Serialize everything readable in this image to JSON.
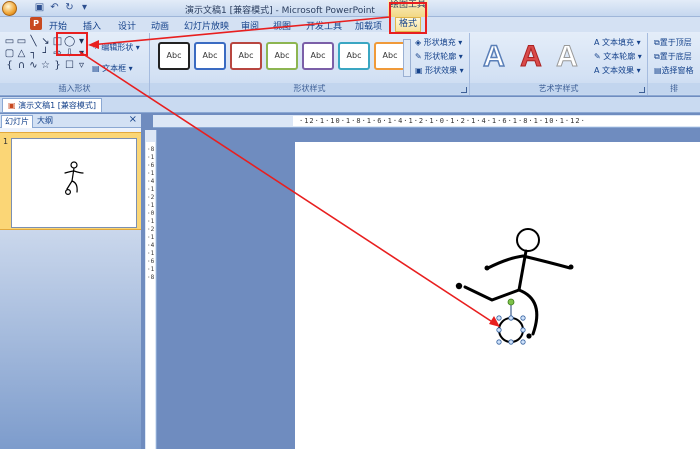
{
  "titlebar": {
    "title": "演示文稿1 [兼容模式] - Microsoft PowerPoint",
    "contextual_tab_group": "绘图工具"
  },
  "tabs": [
    "开始",
    "插入",
    "设计",
    "动画",
    "幻灯片放映",
    "审阅",
    "视图",
    "开发工具",
    "加载项",
    "格式"
  ],
  "active_tab": "格式",
  "ribbon": {
    "insert_shapes": {
      "label": "插入形状",
      "edit_shape": "编辑形状",
      "text_box": "文本框"
    },
    "shape_styles": {
      "label": "形状样式",
      "style_text": "Abc",
      "fill": "形状填充",
      "outline": "形状轮廓",
      "effects": "形状效果"
    },
    "wordart_styles": {
      "label": "艺术字样式",
      "letter": "A",
      "text_fill": "文本填充",
      "text_outline": "文本轮廓",
      "text_effects": "文本效果"
    },
    "arrange": {
      "label": "排",
      "bring_front": "置于顶层",
      "send_back": "置于底层",
      "selection_pane": "选择窗格"
    }
  },
  "document_tab": "演示文稿1 [兼容模式]",
  "left_pane": {
    "tab_slides": "幻灯片",
    "tab_outline": "大纲",
    "close": "×",
    "slide_number": "1"
  },
  "ruler": {
    "horizontal": "·12·1·10·1·8·1·6·1·4·1·2·1·0·1·2·1·4·1·6·1·8·1·10·1·12·",
    "vertical": "·8·1·6·1·4·1·2·1·0·1·2·1·4·1·6·1·8"
  },
  "colors": {
    "annotation": "#e81f1f",
    "office_blue": "#15428b",
    "selection_handle": "#7ec24a"
  },
  "icons": [
    "office-button-icon",
    "save-icon",
    "undo-icon",
    "redo-icon",
    "oval-tool-icon",
    "close-icon"
  ]
}
